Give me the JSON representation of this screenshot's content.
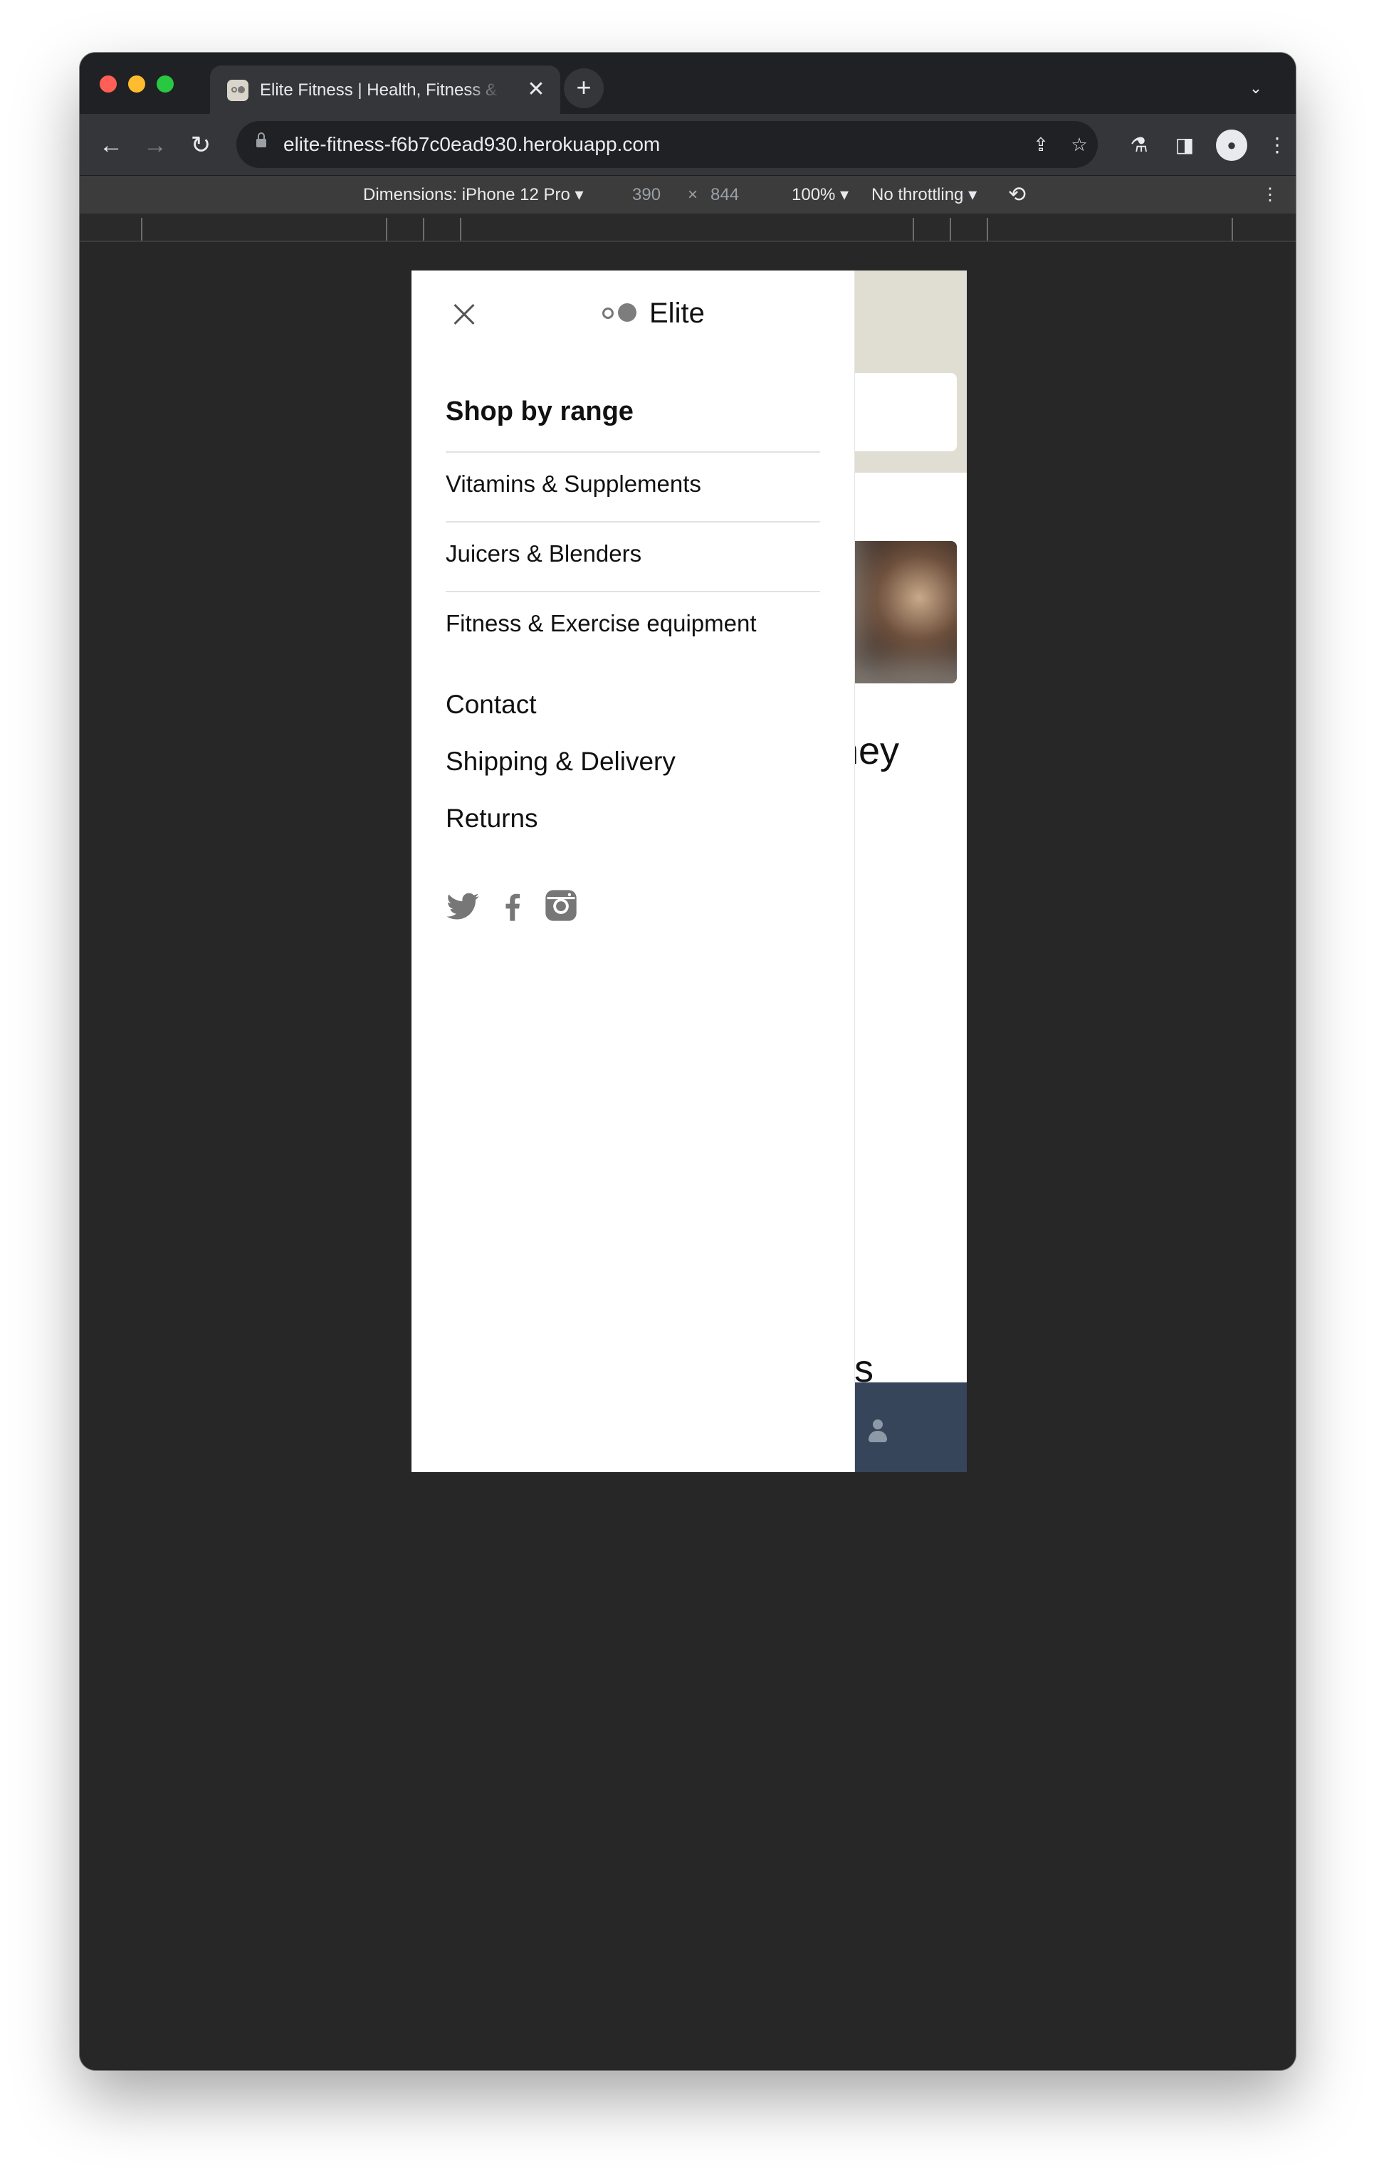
{
  "browser": {
    "tab_title": "Elite Fitness | Health, Fitness & Wellness",
    "url": "elite-fitness-f6b7c0ead930.herokuapp.com",
    "new_tab_symbol": "+",
    "tab_close_symbol": "✕"
  },
  "devtools": {
    "dimensions_label": "Dimensions: iPhone 12 Pro ▾",
    "width": "390",
    "times": "×",
    "height": "844",
    "zoom": "100% ▾",
    "throttling": "No throttling ▾"
  },
  "site": {
    "logo_text": "Elite",
    "background_heading_fragment": "rney",
    "background_heading_fragment_2": "s"
  },
  "drawer": {
    "shop_heading": "Shop by range",
    "shop_items": [
      "Vitamins & Supplements",
      "Juicers & Blenders",
      "Fitness & Exercise equipment"
    ],
    "links": [
      "Contact",
      "Shipping & Delivery",
      "Returns"
    ],
    "social": [
      "twitter-icon",
      "facebook-icon",
      "instagram-icon"
    ]
  },
  "colors": {
    "traffic_red": "#ff5f57",
    "traffic_yellow": "#febc2e",
    "traffic_green": "#28c840",
    "chrome_dark": "#202124",
    "hero_beige": "#e0ddd3",
    "footer_navy": "#364559",
    "social_grey": "#777777"
  }
}
